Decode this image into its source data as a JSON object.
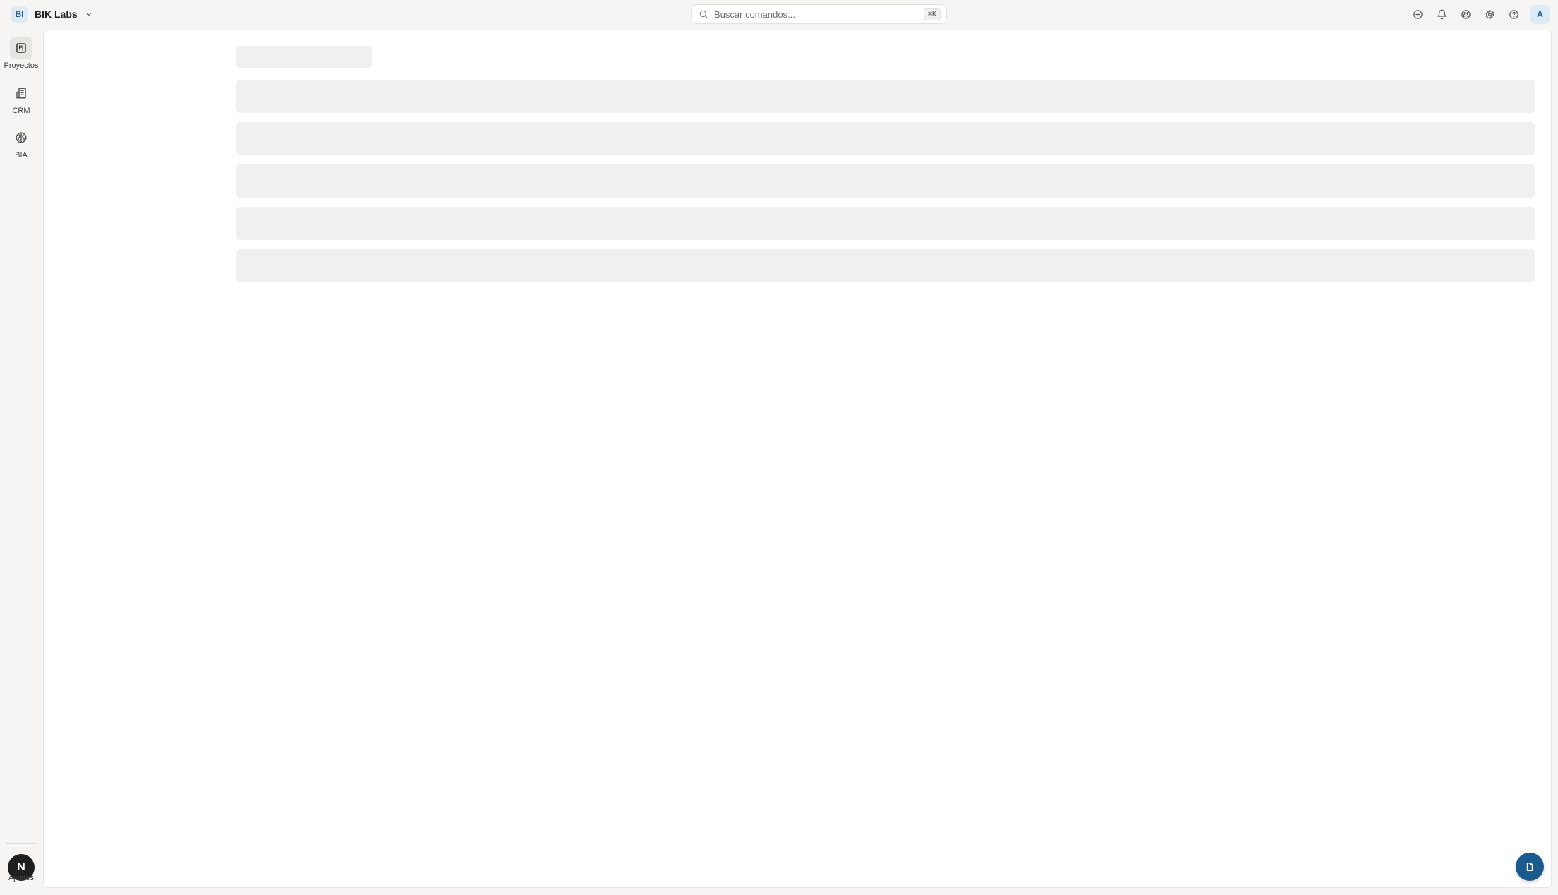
{
  "workspace": {
    "badge": "BI",
    "name": "BIK Labs",
    "chevron_icon": "chevron-down-icon"
  },
  "search": {
    "placeholder": "Buscar comandos...",
    "shortcut": "⌘K",
    "icon": "search-icon"
  },
  "top_actions": [
    {
      "name": "add-circle-icon"
    },
    {
      "name": "bell-icon"
    },
    {
      "name": "brain-icon"
    },
    {
      "name": "gear-icon"
    },
    {
      "name": "help-circle-icon"
    }
  ],
  "user": {
    "initial": "A"
  },
  "rail": {
    "items": [
      {
        "label": "Proyectos",
        "icon": "kanban-board-icon",
        "active": true
      },
      {
        "label": "CRM",
        "icon": "building-icon",
        "active": false
      },
      {
        "label": "BIA",
        "icon": "brain-icon",
        "active": false
      }
    ],
    "settings": {
      "label": "Ajustes",
      "badge": "N"
    }
  },
  "main": {
    "loading_skeleton": {
      "title_placeholders": 1,
      "row_placeholders": 5
    }
  },
  "fab": {
    "icon": "document-icon"
  },
  "colors": {
    "accent": "#1b5a8d",
    "badge_bg": "#dcebf6",
    "skeleton": "#eff0ef",
    "background": "#f6f5f3"
  }
}
